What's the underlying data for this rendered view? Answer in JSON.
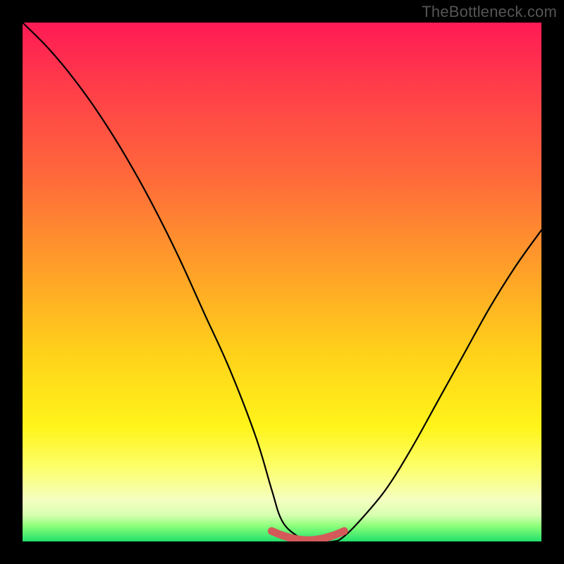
{
  "watermark": "TheBottleneck.com",
  "colors": {
    "background": "#000000",
    "curve_main": "#000000",
    "curve_accent": "#d45a5a",
    "gradient_stops": [
      "#ff1a55",
      "#ff3c4a",
      "#ff6a3a",
      "#ffa128",
      "#ffd21a",
      "#fff41a",
      "#fcff6e",
      "#f4ffc0",
      "#d6ffb0",
      "#8cff7a",
      "#22e06a"
    ]
  },
  "chart_data": {
    "type": "line",
    "title": "",
    "xlabel": "",
    "ylabel": "",
    "xlim": [
      0,
      100
    ],
    "ylim": [
      0,
      100
    ],
    "grid": false,
    "legend": false,
    "series": [
      {
        "name": "bottleneck-curve",
        "color": "#000000",
        "x": [
          0,
          5,
          10,
          15,
          20,
          25,
          30,
          35,
          40,
          45,
          48,
          50,
          53,
          56,
          60,
          62,
          65,
          70,
          75,
          80,
          85,
          90,
          95,
          100
        ],
        "y": [
          100,
          95,
          89,
          82,
          74,
          65,
          55,
          44,
          33,
          20,
          10,
          4,
          1,
          0,
          0,
          1,
          4,
          10,
          18,
          27,
          36,
          45,
          53,
          60
        ]
      },
      {
        "name": "sweet-spot-highlight",
        "color": "#d45a5a",
        "x": [
          48,
          50,
          52,
          54,
          56,
          58,
          60,
          62
        ],
        "y": [
          2,
          1.2,
          0.6,
          0.3,
          0.3,
          0.6,
          1.2,
          2
        ]
      }
    ],
    "annotations": []
  }
}
